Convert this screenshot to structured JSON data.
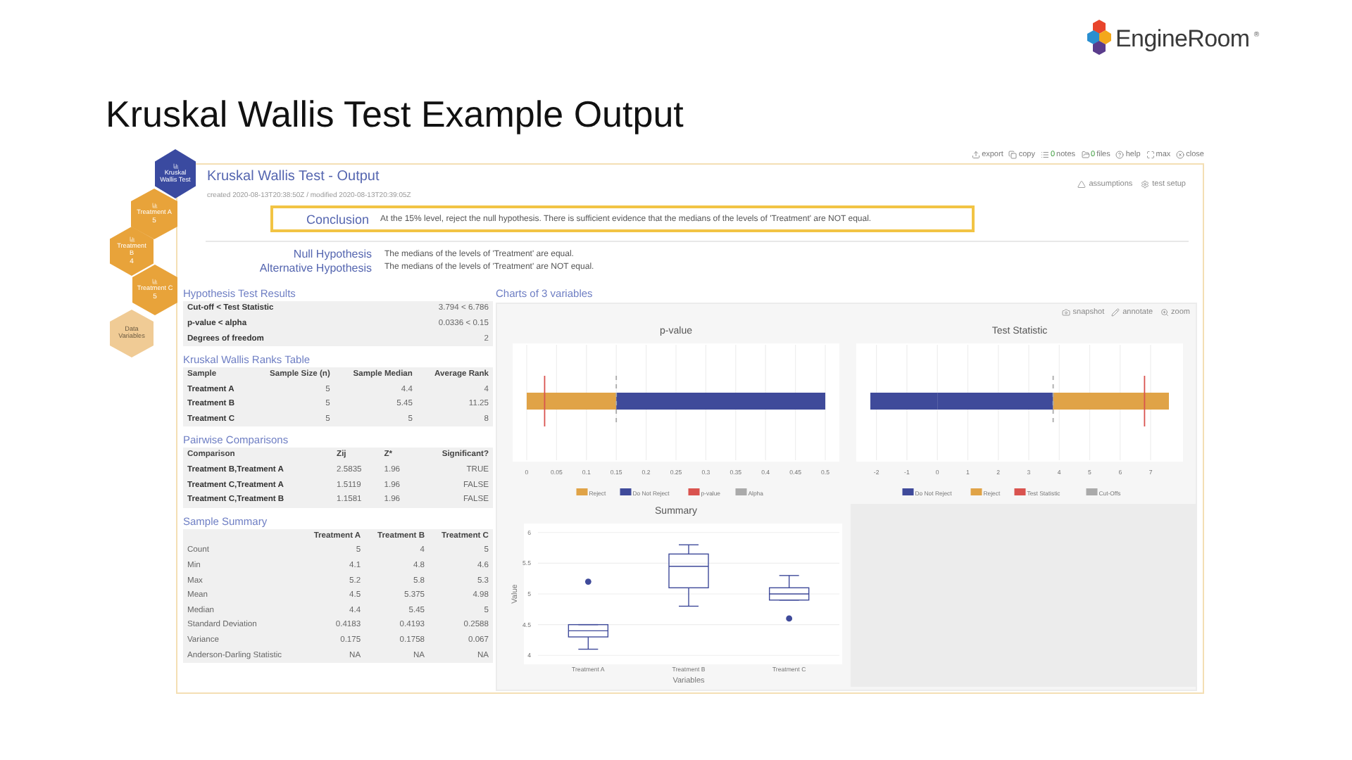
{
  "logo": {
    "name": "EngineRoom",
    "mark": "®"
  },
  "slide_title": "Kruskal Wallis Test Example Output",
  "nodes": [
    {
      "label": "Kruskal Wallis Test",
      "kind": "test"
    },
    {
      "label": "Treatment A",
      "count": "5",
      "kind": "variable"
    },
    {
      "label": "Treatment B",
      "count": "4",
      "kind": "variable"
    },
    {
      "label": "Treatment C",
      "count": "5",
      "kind": "variable"
    },
    {
      "label": "Data Variables",
      "kind": "data"
    }
  ],
  "toolbar": [
    {
      "label": "export"
    },
    {
      "label": "copy"
    },
    {
      "count": "0",
      "label": "notes"
    },
    {
      "count": "0",
      "label": "files"
    },
    {
      "label": "help"
    },
    {
      "label": "max"
    },
    {
      "label": "close"
    }
  ],
  "output": {
    "title": "Kruskal Wallis Test - Output",
    "meta": "created 2020-08-13T20:38:50Z / modified 2020-08-13T20:39:05Z",
    "actions": [
      "assumptions",
      "test setup"
    ]
  },
  "conclusion": {
    "label": "Conclusion",
    "text": "At the 15% level, reject the null hypothesis. There is sufficient evidence that the medians of the levels of 'Treatment' are NOT equal."
  },
  "hypotheses": [
    {
      "label": "Null Hypothesis",
      "text": "The medians of the levels of 'Treatment' are equal."
    },
    {
      "label": "Alternative Hypothesis",
      "text": "The medians of the levels of 'Treatment' are NOT equal."
    }
  ],
  "test_results": {
    "title": "Hypothesis Test Results",
    "rows": [
      [
        "Cut-off < Test Statistic",
        "3.794 < 6.786"
      ],
      [
        "p-value < alpha",
        "0.0336 < 0.15"
      ],
      [
        "Degrees of freedom",
        "2"
      ]
    ]
  },
  "ranks": {
    "title": "Kruskal Wallis Ranks Table",
    "columns": [
      "Sample",
      "Sample Size (n)",
      "Sample Median",
      "Average Rank"
    ],
    "rows": [
      [
        "Treatment A",
        "5",
        "4.4",
        "4"
      ],
      [
        "Treatment B",
        "5",
        "5.45",
        "11.25"
      ],
      [
        "Treatment C",
        "5",
        "5",
        "8"
      ]
    ]
  },
  "pairwise": {
    "title": "Pairwise Comparisons",
    "columns": [
      "Comparison",
      "Zij",
      "Z*",
      "Significant?"
    ],
    "rows": [
      [
        "Treatment B,Treatment A",
        "2.5835",
        "1.96",
        "TRUE"
      ],
      [
        "Treatment C,Treatment A",
        "1.5119",
        "1.96",
        "FALSE"
      ],
      [
        "Treatment C,Treatment B",
        "1.1581",
        "1.96",
        "FALSE"
      ]
    ]
  },
  "summary": {
    "title": "Sample Summary",
    "columns": [
      "",
      "Treatment A",
      "Treatment B",
      "Treatment C"
    ],
    "rows": [
      [
        "Count",
        "5",
        "4",
        "5"
      ],
      [
        "Min",
        "4.1",
        "4.8",
        "4.6"
      ],
      [
        "Max",
        "5.2",
        "5.8",
        "5.3"
      ],
      [
        "Mean",
        "4.5",
        "5.375",
        "4.98"
      ],
      [
        "Median",
        "4.4",
        "5.45",
        "5"
      ],
      [
        "Standard Deviation",
        "0.4183",
        "0.4193",
        "0.2588"
      ],
      [
        "Variance",
        "0.175",
        "0.1758",
        "0.067"
      ],
      [
        "Anderson-Darling Statistic",
        "NA",
        "NA",
        "NA"
      ]
    ]
  },
  "charts": {
    "title": "Charts of 3 variables",
    "tools": [
      "snapshot",
      "annotate",
      "zoom"
    ],
    "pvalue": {
      "chart_data": {
        "type": "bar",
        "orientation": "horizontal",
        "stacked": true,
        "title": "p-value",
        "xlim": [
          0,
          0.5
        ],
        "xticks": [
          0,
          0.05,
          0.1,
          0.15,
          0.2,
          0.25,
          0.3,
          0.35,
          0.4,
          0.45,
          0.5
        ],
        "grid": true,
        "legend": "bottom",
        "series": [
          {
            "name": "Reject",
            "color": "#e0a347",
            "values": [
              0.15
            ]
          },
          {
            "name": "Do Not Reject",
            "color": "#3f4a9a",
            "values": [
              0.35
            ]
          }
        ],
        "ref_lines": [
          {
            "axis": "x",
            "value": 0.03,
            "label": "p-value",
            "color": "#d9534f"
          },
          {
            "axis": "x",
            "value": 0.15,
            "label": "Alpha",
            "color": "#aaaaaa"
          }
        ]
      }
    },
    "statistic": {
      "chart_data": {
        "type": "bar",
        "orientation": "horizontal",
        "stacked": true,
        "title": "Test Statistic",
        "xlim": [
          -2.2,
          7.6
        ],
        "xticks": [
          -2,
          -1,
          0,
          1,
          2,
          3,
          4,
          5,
          6,
          7
        ],
        "grid": true,
        "legend": "bottom",
        "series": [
          {
            "name": "Do Not Reject",
            "color": "#3f4a9a",
            "values": [
              3.8
            ]
          },
          {
            "name": "Reject",
            "color": "#e0a347",
            "values": [
              3.8
            ]
          },
          {
            "color": "#3f4a9a",
            "values": [
              -2.2
            ]
          }
        ],
        "ref_lines": [
          {
            "axis": "x",
            "value": 6.8,
            "label": "Test Statistic",
            "color": "#d9534f"
          },
          {
            "axis": "x",
            "value": 3.8,
            "label": "Cut-Offs",
            "color": "#aaaaaa"
          }
        ]
      }
    },
    "summary": {
      "title": "Summary",
      "xlabel": "Variables",
      "ylabel": "Value",
      "yticks": [
        "6",
        "5.5",
        "5",
        "4.5",
        "4"
      ],
      "categories": [
        "Treatment A",
        "Treatment B",
        "Treatment C"
      ]
    }
  }
}
